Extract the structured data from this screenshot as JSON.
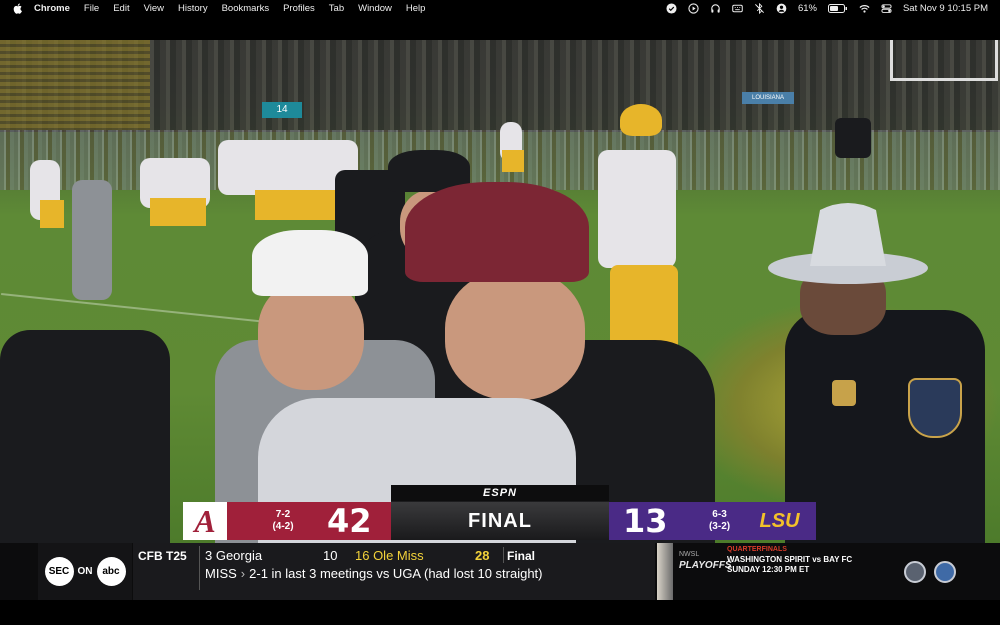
{
  "menubar": {
    "app_name": "Chrome",
    "menus": [
      "File",
      "Edit",
      "View",
      "History",
      "Bookmarks",
      "Profiles",
      "Tab",
      "Window",
      "Help"
    ],
    "battery": "61%",
    "datetime": "Sat Nov 9  10:15 PM"
  },
  "video": {
    "mini_scoreboard": "14",
    "stadium_banner": "LOUISIANA"
  },
  "scorebug": {
    "network": "ESPN",
    "status": "FINAL",
    "away": {
      "logo_letter": "A",
      "record_overall": "7-2",
      "record_conf": "(4-2)",
      "score": "42",
      "color": "#a0203a"
    },
    "home": {
      "name": "LSU",
      "record_overall": "6-3",
      "record_conf": "(3-2)",
      "score": "13",
      "color": "#4a2a86"
    }
  },
  "bottomline": {
    "network_left": "SEC",
    "network_on": "ON",
    "network_right": "abc",
    "label": "CFB T25",
    "game": {
      "team1": "3 Georgia",
      "score1": "10",
      "team2": "16 Ole Miss",
      "score2": "28",
      "status": "Final"
    },
    "ticker": {
      "prefix": "MISS",
      "text": "2-1 in last 3 meetings vs UGA (had lost 10 straight)"
    },
    "ad": {
      "brand": "PLAYOFFS",
      "brand_small": "NWSL",
      "headline": "QUARTERFINALS",
      "matchup": "WASHINGTON SPIRIT vs BAY FC",
      "time": "SUNDAY 12:30 PM ET"
    }
  },
  "colors": {
    "alabama_crimson": "#a0203a",
    "lsu_purple": "#4a2a86",
    "lsu_gold": "#f3c12a",
    "highlight_yellow": "#f2d23a"
  }
}
